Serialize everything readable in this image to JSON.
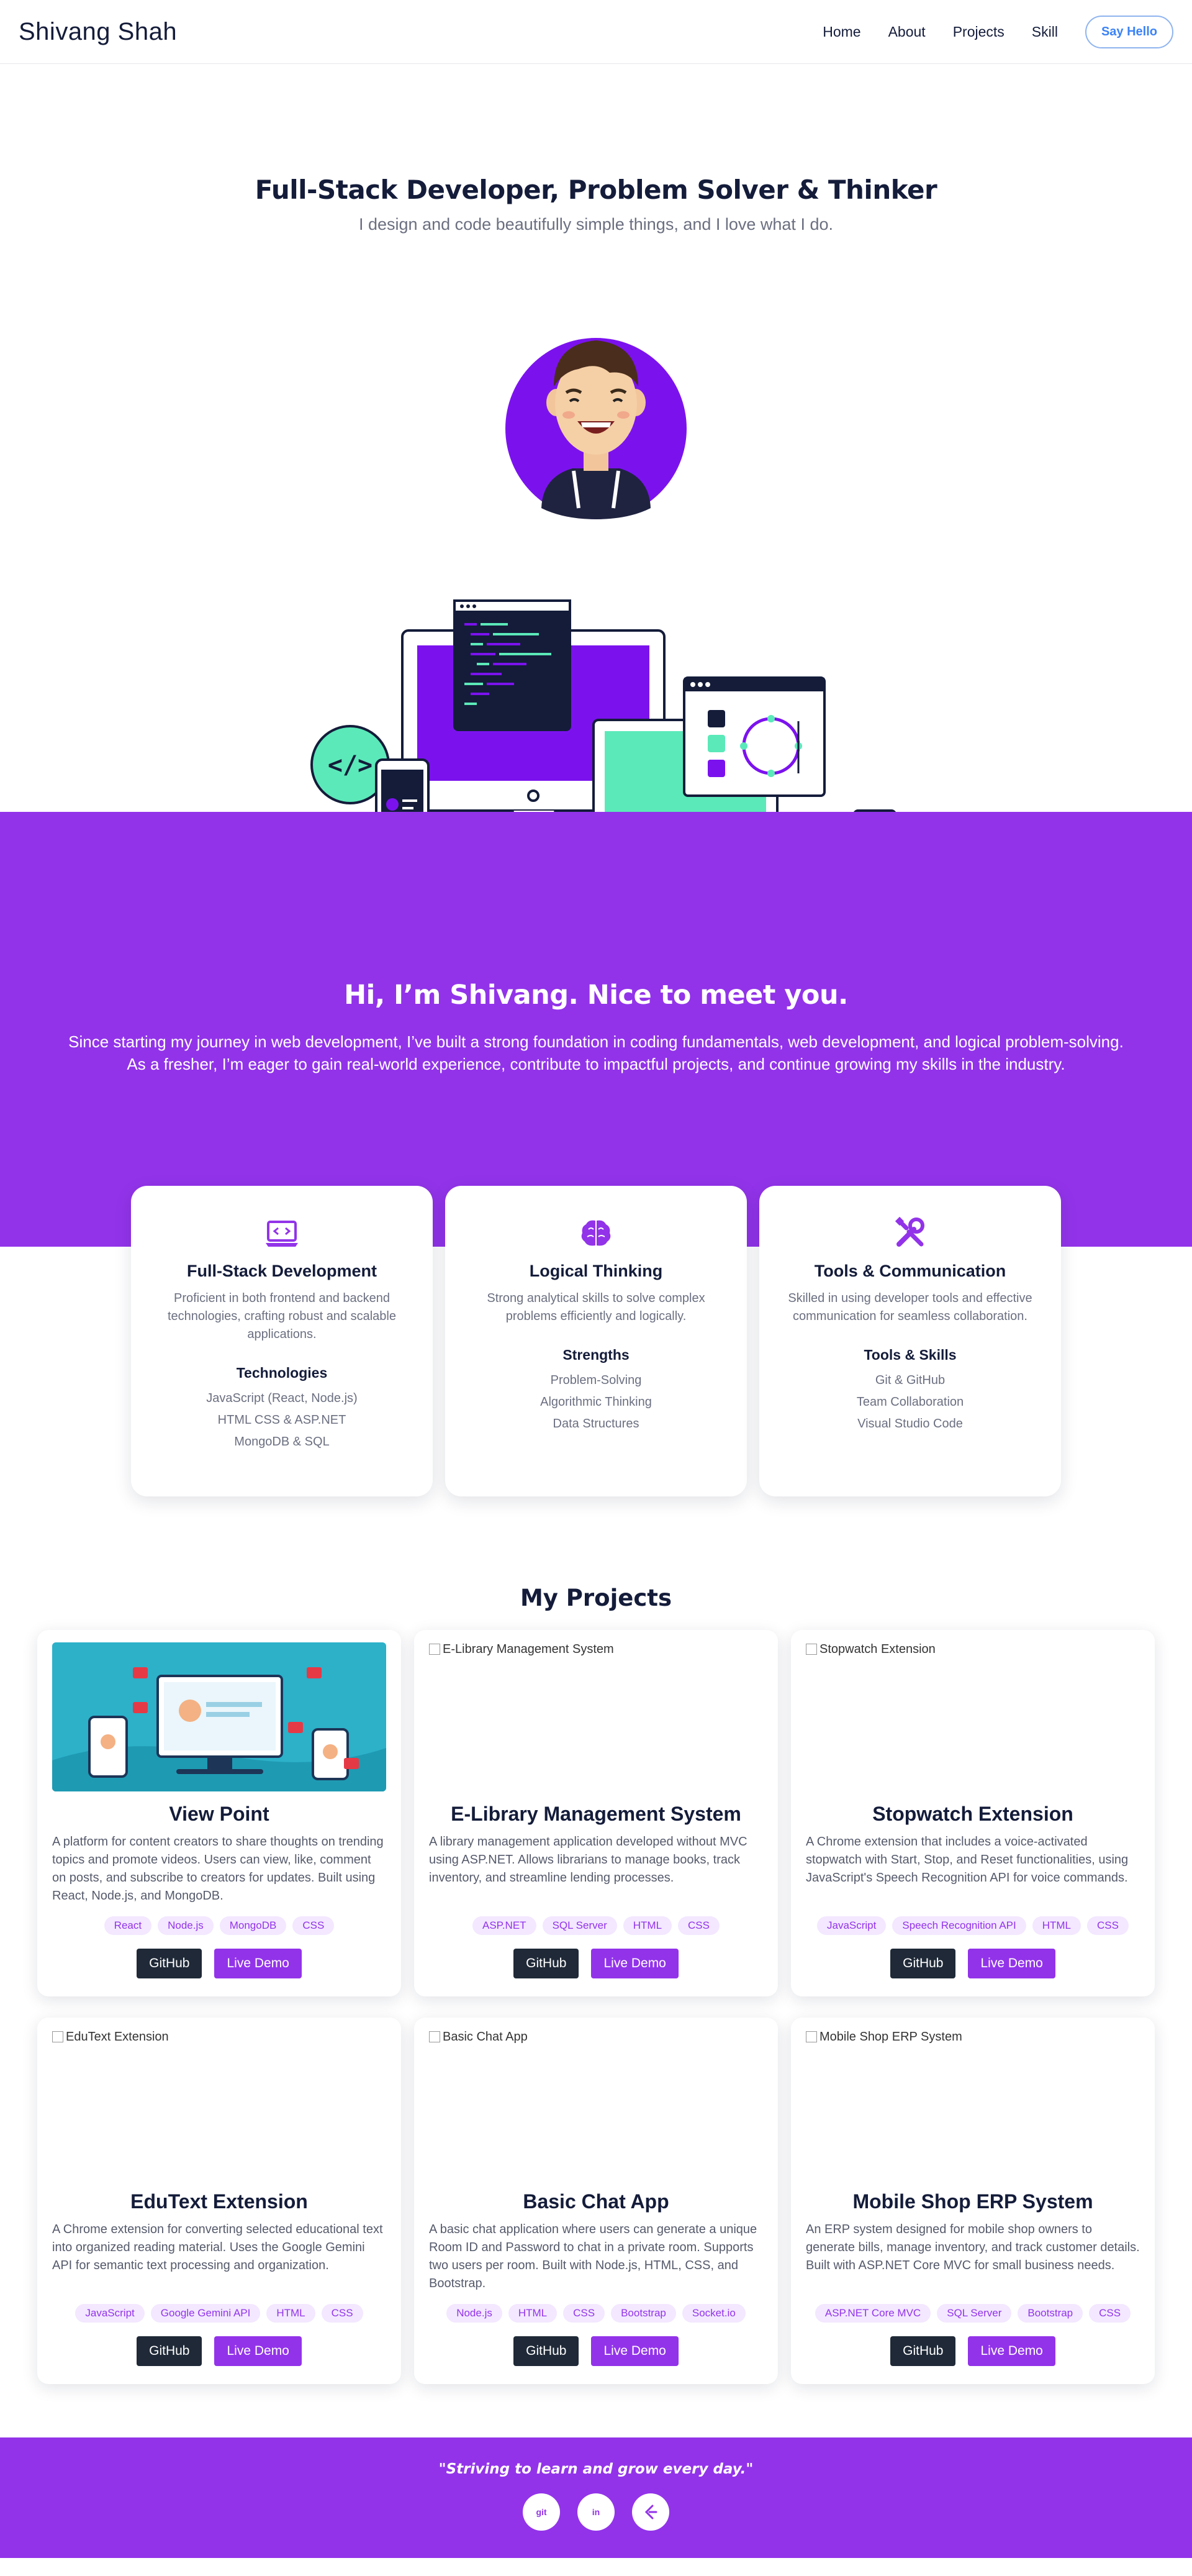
{
  "nav": {
    "brand": "Shivang Shah",
    "links": [
      "Home",
      "About",
      "Projects",
      "Skill"
    ],
    "cta": "Say Hello"
  },
  "hero": {
    "title": "Full-Stack Developer, Problem Solver & Thinker",
    "subtitle": "I design and code beautifully simple things, and I love what I do."
  },
  "about": {
    "title": "Hi, I’m Shivang. Nice to meet you.",
    "line1": "Since starting my journey in web development, I’ve built a strong foundation in coding fundamentals, web development, and logical problem-solving.",
    "line2": "As a fresher, I’m eager to gain real-world experience, contribute to impactful projects, and continue growing my skills in the industry."
  },
  "skills": [
    {
      "icon": "laptop-code-icon",
      "title": "Full-Stack Development",
      "desc": "Proficient in both frontend and backend technologies, crafting robust and scalable applications.",
      "subtitle": "Technologies",
      "items": [
        "JavaScript (React, Node.js)",
        "HTML CSS & ASP.NET",
        "MongoDB & SQL"
      ]
    },
    {
      "icon": "brain-icon",
      "title": "Logical Thinking",
      "desc": "Strong analytical skills to solve complex problems efficiently and logically.",
      "subtitle": "Strengths",
      "items": [
        "Problem-Solving",
        "Algorithmic Thinking",
        "Data Structures"
      ]
    },
    {
      "icon": "tools-icon",
      "title": "Tools & Communication",
      "desc": "Skilled in using developer tools and effective communication for seamless collaboration.",
      "subtitle": "Tools & Skills",
      "items": [
        "Git & GitHub",
        "Team Collaboration",
        "Visual Studio Code"
      ]
    }
  ],
  "projects_heading": "My Projects",
  "projects": [
    {
      "title": "View Point",
      "alt": "",
      "desc": "A platform for content creators to share thoughts on trending topics and promote videos. Users can view, like, comment on posts, and subscribe to creators for updates. Built using React, Node.js, and MongoDB.",
      "tags": [
        "React",
        "Node.js",
        "MongoDB",
        "CSS"
      ]
    },
    {
      "title": "E-Library Management System",
      "alt": "E-Library Management System",
      "desc": "A library management application developed without MVC using ASP.NET. Allows librarians to manage books, track inventory, and streamline lending processes.",
      "tags": [
        "ASP.NET",
        "SQL Server",
        "HTML",
        "CSS"
      ]
    },
    {
      "title": "Stopwatch Extension",
      "alt": "Stopwatch Extension",
      "desc": "A Chrome extension that includes a voice-activated stopwatch with Start, Stop, and Reset functionalities, using JavaScript's Speech Recognition API for voice commands.",
      "tags": [
        "JavaScript",
        "Speech Recognition API",
        "HTML",
        "CSS"
      ]
    },
    {
      "title": "EduText Extension",
      "alt": "EduText Extension",
      "desc": "A Chrome extension for converting selected educational text into organized reading material. Uses the Google Gemini API for semantic text processing and organization.",
      "tags": [
        "JavaScript",
        "Google Gemini API",
        "HTML",
        "CSS"
      ]
    },
    {
      "title": "Basic Chat App",
      "alt": "Basic Chat App",
      "desc": "A basic chat application where users can generate a unique Room ID and Password to chat in a private room. Supports two users per room. Built with Node.js, HTML, CSS, and Bootstrap.",
      "tags": [
        "Node.js",
        "HTML",
        "CSS",
        "Bootstrap",
        "Socket.io"
      ]
    },
    {
      "title": "Mobile Shop ERP System",
      "alt": "Mobile Shop ERP System",
      "desc": "An ERP system designed for mobile shop owners to generate bills, manage inventory, and track customer details. Built with ASP.NET Core MVC for small business needs.",
      "tags": [
        "ASP.NET Core MVC",
        "SQL Server",
        "Bootstrap",
        "CSS"
      ]
    }
  ],
  "buttons": {
    "github": "GitHub",
    "demo": "Live Demo"
  },
  "footer": {
    "quote": "\"Striving to learn and grow every day.\"",
    "socials": [
      {
        "label": "git",
        "icon": "git-icon"
      },
      {
        "label": "in",
        "icon": "linkedin-icon"
      },
      {
        "label": "",
        "icon": "leetcode-icon"
      }
    ]
  },
  "colors": {
    "accent": "#9233e9",
    "dark": "#141c3a",
    "mint": "#5be9b9",
    "button_dark": "#1f2937"
  }
}
